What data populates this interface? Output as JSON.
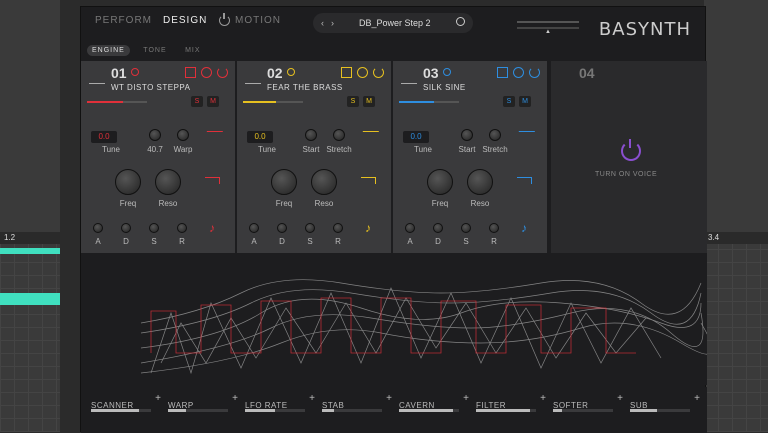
{
  "nav": {
    "perform": "PERFORM",
    "design": "DESIGN",
    "motion": "MOTION"
  },
  "subtabs": [
    "ENGINE",
    "TONE",
    "MIX"
  ],
  "preset": {
    "name": "DB_Power Step 2"
  },
  "logo": "BASYNTH",
  "daw": {
    "left_marker": "1.2",
    "right_marker": "3.4"
  },
  "voices": [
    {
      "num": "01",
      "name": "WT DISTO STEPPA",
      "accent": "#e0303a",
      "level": 0.6,
      "tune_value": "0.0",
      "tune": "Tune",
      "k2_value": "40.7",
      "k2": "",
      "k3": "Warp",
      "freq": "Freq",
      "reso": "Reso",
      "a": "A",
      "d": "D",
      "s": "S",
      "r": "R",
      "solo": "S",
      "mute": "M"
    },
    {
      "num": "02",
      "name": "FEAR THE BRASS",
      "accent": "#e6c020",
      "level": 0.55,
      "tune_value": "0.0",
      "tune": "Tune",
      "k2": "Start",
      "k3": "Stretch",
      "freq": "Freq",
      "reso": "Reso",
      "a": "A",
      "d": "D",
      "s": "S",
      "r": "R",
      "solo": "S",
      "mute": "M"
    },
    {
      "num": "03",
      "name": "SILK SINE",
      "accent": "#2e8ee0",
      "level": 0.58,
      "tune_value": "0.0",
      "tune": "Tune",
      "k2": "Start",
      "k3": "Stretch",
      "freq": "Freq",
      "reso": "Reso",
      "a": "A",
      "d": "D",
      "s": "S",
      "r": "R",
      "solo": "S",
      "mute": "M"
    }
  ],
  "voice4": {
    "num": "04",
    "label": "TURN ON VOICE",
    "accent": "#8a4fd0"
  },
  "macros": [
    {
      "name": "SCANNER",
      "value": 0.8
    },
    {
      "name": "WARP",
      "value": 0.3
    },
    {
      "name": "LFO RATE",
      "value": 0.5
    },
    {
      "name": "STAB",
      "value": 0.2
    },
    {
      "name": "CAVERN",
      "value": 0.9
    },
    {
      "name": "FILTER",
      "value": 0.9
    },
    {
      "name": "SOFTER",
      "value": 0.15
    },
    {
      "name": "SUB",
      "value": 0.45
    }
  ]
}
